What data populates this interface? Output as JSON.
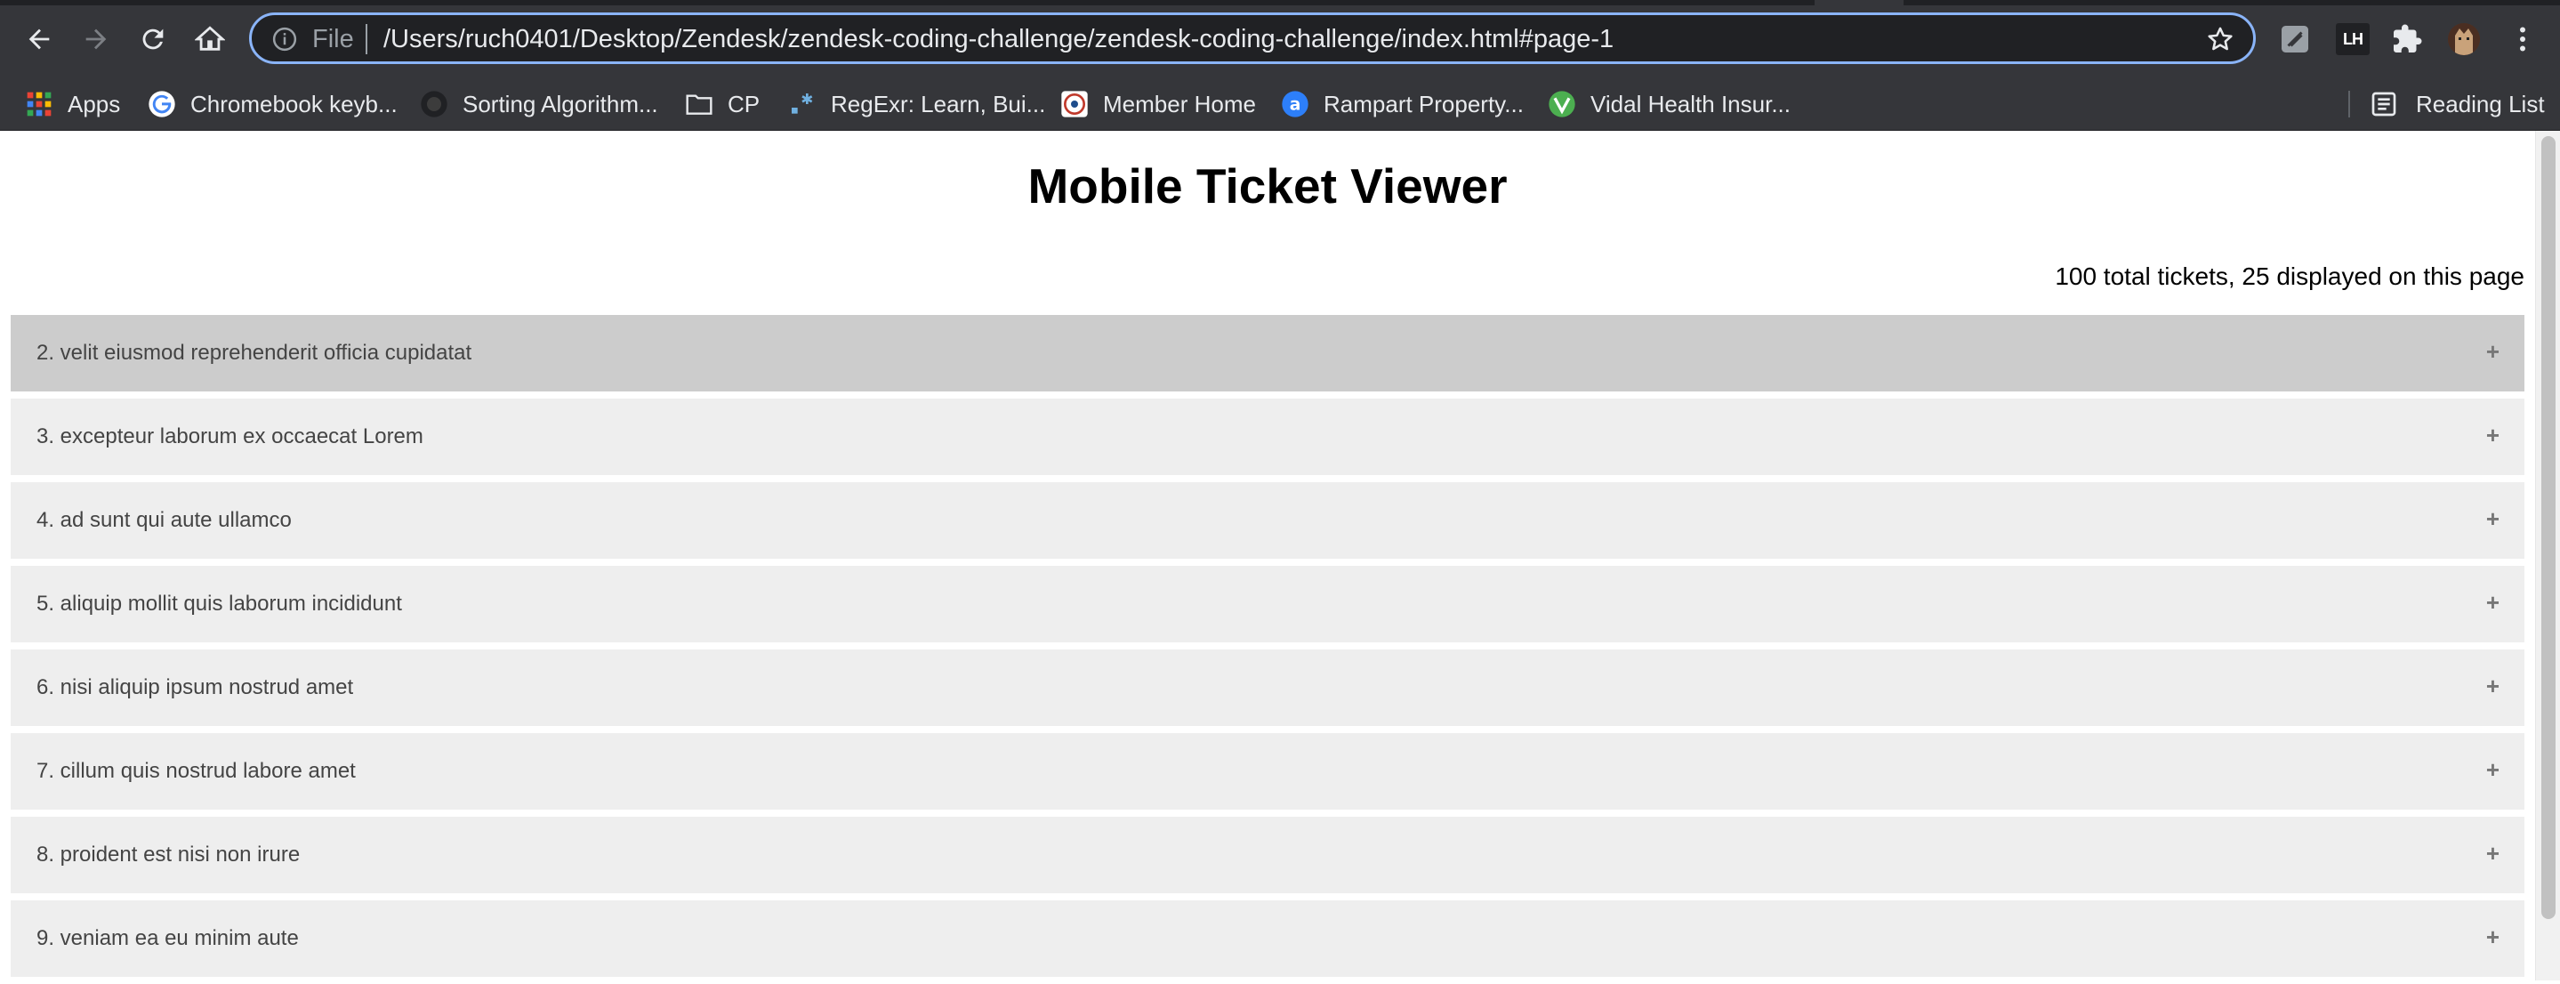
{
  "browser": {
    "omnibox": {
      "scheme_label": "File",
      "url": "/Users/ruch0401/Desktop/Zendesk/zendesk-coding-challenge/zendesk-coding-challenge/index.html#page-1"
    },
    "extension_text": "LH",
    "bookmarks": [
      {
        "label": "Apps",
        "icon": "apps-grid-icon"
      },
      {
        "label": "Chromebook keyb...",
        "icon": "google-icon"
      },
      {
        "label": "Sorting Algorithm...",
        "icon": "site-favicon-dark"
      },
      {
        "label": "CP",
        "icon": "folder-icon"
      },
      {
        "label": "RegExr: Learn, Bui...",
        "icon": "regexr-icon"
      },
      {
        "label": "Member Home",
        "icon": "member-favicon"
      },
      {
        "label": "Rampart Property...",
        "icon": "rampart-favicon"
      },
      {
        "label": "Vidal Health Insur...",
        "icon": "vidal-favicon"
      }
    ],
    "reading_list_label": "Reading List"
  },
  "page": {
    "title": "Mobile Ticket Viewer",
    "ticket_count": "100 total tickets, 25 displayed on this page",
    "tickets": [
      {
        "label": "2. velit eiusmod reprehenderit officia cupidatat",
        "toggle": "+"
      },
      {
        "label": "3. excepteur laborum ex occaecat Lorem",
        "toggle": "+"
      },
      {
        "label": "4. ad sunt qui aute ullamco",
        "toggle": "+"
      },
      {
        "label": "5. aliquip mollit quis laborum incididunt",
        "toggle": "+"
      },
      {
        "label": "6. nisi aliquip ipsum nostrud amet",
        "toggle": "+"
      },
      {
        "label": "7. cillum quis nostrud labore amet",
        "toggle": "+"
      },
      {
        "label": "8. proident est nisi non irure",
        "toggle": "+"
      },
      {
        "label": "9. veniam ea eu minim aute",
        "toggle": "+"
      }
    ]
  },
  "colors": {
    "chrome_bg": "#35363a",
    "omnibox_focus": "#8ab4f8",
    "row_bg": "#eeeeee",
    "row_active_bg": "#cccccc"
  }
}
